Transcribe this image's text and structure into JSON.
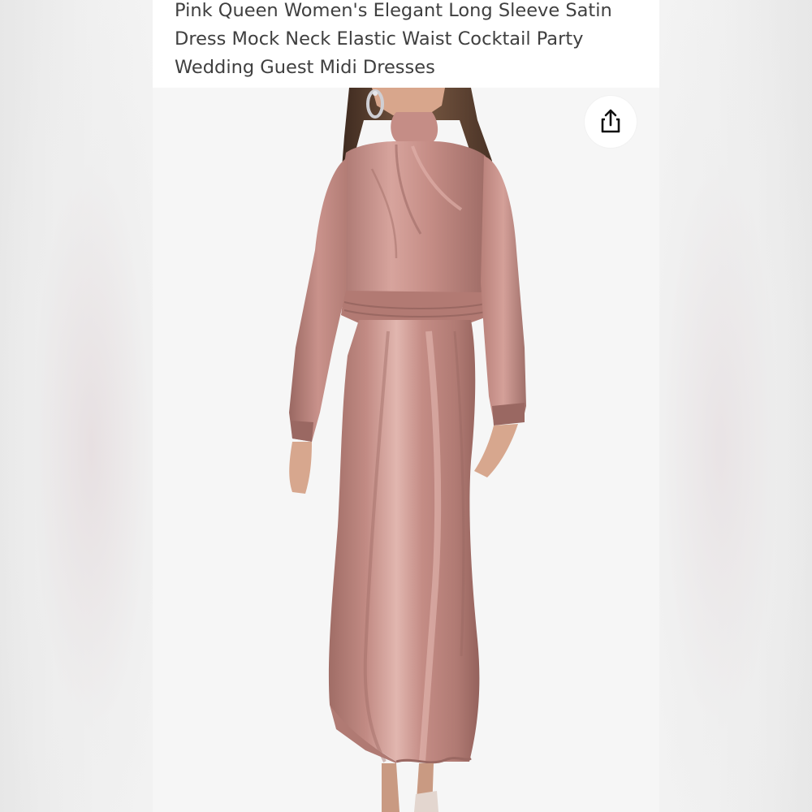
{
  "product": {
    "title": "Pink Queen Women's Elegant Long Sleeve Satin Dress Mock Neck Elastic Waist Cocktail Party Wedding Guest Midi Dresses"
  },
  "actions": {
    "share_icon": "share-icon"
  },
  "colors": {
    "dress": "#c58d86",
    "dress_highlight": "#deb1aa",
    "dress_shadow": "#9c6a64",
    "hair": "#5a4030",
    "skin": "#d9a98f",
    "background": "#f6f6f6"
  }
}
